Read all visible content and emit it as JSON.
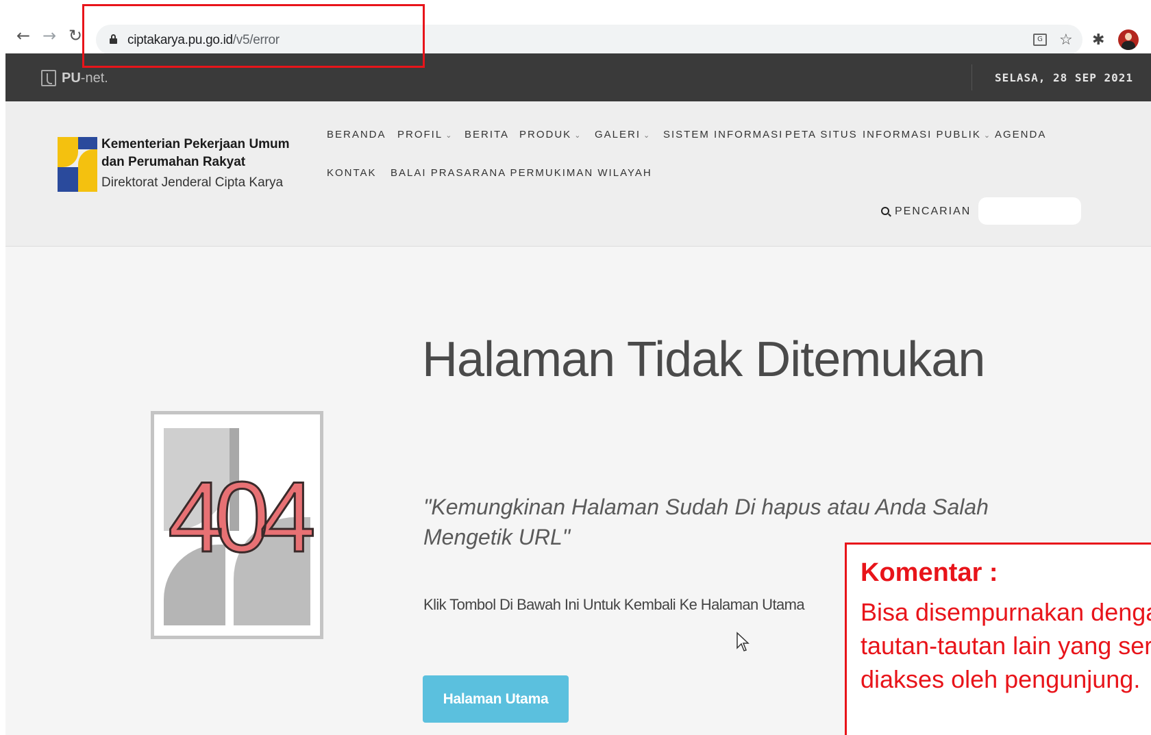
{
  "browser": {
    "url_host": "ciptakarya.pu.go.id",
    "url_path": "/v5/error"
  },
  "topbar": {
    "brand_bold": "PU",
    "brand_rest": "-net.",
    "date": "SELASA, 28 SEP 2021"
  },
  "logo": {
    "line1": "Kementerian Pekerjaan Umum",
    "line2": "dan Perumahan Rakyat",
    "line3": "Direktorat Jenderal Cipta Karya"
  },
  "menu": {
    "items": [
      {
        "label": "BERANDA"
      },
      {
        "label": "PROFIL"
      },
      {
        "label": "BERITA"
      },
      {
        "label": "PRODUK"
      },
      {
        "label": "GALERI"
      },
      {
        "label": "SISTEM INFORMASI"
      },
      {
        "label": "PETA SITUS"
      },
      {
        "label": "INFORMASI PUBLIK"
      },
      {
        "label": "AGENDA"
      },
      {
        "label": "KONTAK"
      },
      {
        "label": "BALAI PRASARANA PERMUKIMAN WILAYAH"
      }
    ],
    "search_label": "PENCARIAN",
    "search_value": ""
  },
  "error": {
    "image_text": "404",
    "title": "Halaman Tidak Ditemukan",
    "subtitle": "\"Kemungkinan Halaman Sudah Di hapus atau Anda Salah Mengetik URL\"",
    "hint": "Klik Tombol Di Bawah Ini Untuk Kembali Ke Halaman Utama",
    "button": "Halaman Utama"
  },
  "comment": {
    "title": "Komentar :",
    "body": "Bisa disempurnakan dengan tautan-tautan lain yang sering diakses oleh pengunjung."
  },
  "colors": {
    "annotation": "#e8141a",
    "topbar": "#3a3a3a",
    "button": "#5bc0de"
  }
}
